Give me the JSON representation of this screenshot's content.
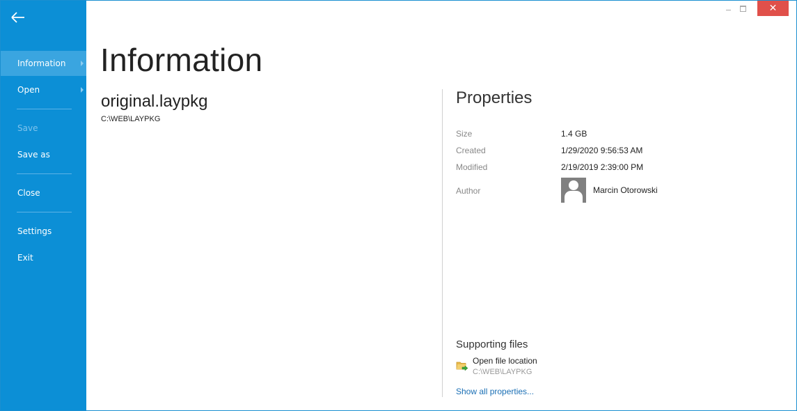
{
  "window": {
    "minimize_icon": "minimize-icon",
    "maximize_icon": "maximize-icon",
    "close_glyph": "✕",
    "close_color": "#e0504a",
    "accent": "#0c8fd6"
  },
  "sidebar": {
    "back_icon": "arrow-left-icon",
    "items": [
      {
        "label": "Information",
        "active": true,
        "submenu": true
      },
      {
        "label": "Open",
        "submenu": true
      },
      {
        "label": "Save",
        "disabled": true
      },
      {
        "label": "Save as"
      },
      {
        "label": "Close"
      },
      {
        "label": "Settings"
      },
      {
        "label": "Exit"
      }
    ]
  },
  "main": {
    "title": "Information",
    "file_name": "original.laypkg",
    "file_path": "C:\\WEB\\LAYPKG"
  },
  "properties": {
    "title": "Properties",
    "rows": [
      {
        "label": "Size",
        "value": "1.4 GB"
      },
      {
        "label": "Created",
        "value": "1/29/2020 9:56:53 AM"
      },
      {
        "label": "Modified",
        "value": "2/19/2019 2:39:00 PM"
      },
      {
        "label": "Author",
        "value": "Marcin Otorowski"
      }
    ]
  },
  "supporting": {
    "title": "Supporting files",
    "open_location_label": "Open file location",
    "open_location_path": "C:\\WEB\\LAYPKG",
    "show_all_label": "Show all properties..."
  }
}
